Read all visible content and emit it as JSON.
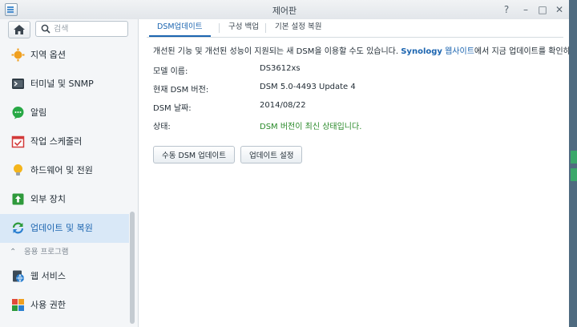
{
  "window": {
    "title": "제어판"
  },
  "search": {
    "placeholder": "검색"
  },
  "sidebar": {
    "items": [
      {
        "label": "지역 옵션"
      },
      {
        "label": "터미널 및 SNMP"
      },
      {
        "label": "알림"
      },
      {
        "label": "작업 스케줄러"
      },
      {
        "label": "하드웨어 및 전원"
      },
      {
        "label": "외부 장치"
      },
      {
        "label": "업데이트 및 복원",
        "active": true
      }
    ],
    "section": {
      "label": "응용 프로그램"
    },
    "items2": [
      {
        "label": "웹 서비스"
      },
      {
        "label": "사용 권한"
      }
    ]
  },
  "tabs": [
    {
      "label": "DSM업데이트",
      "active": true
    },
    {
      "label": "구성 백업"
    },
    {
      "label": "기본 설정 복원"
    }
  ],
  "description": {
    "prefix": "개선된 기능 및 개선된 성능이 지원되는 새 DSM을 이용할 수도 있습니다. ",
    "brand": "Synology",
    "link": " 웹사이트",
    "suffix": "에서 지금 업데이트를 확인하십시오."
  },
  "info": {
    "model_label": "모델 이름:",
    "model_value": "DS3612xs",
    "version_label": "현재 DSM 버전:",
    "version_value": "DSM 5.0-4493 Update 4",
    "date_label": "DSM 날짜:",
    "date_value": "2014/08/22",
    "status_label": "상태:",
    "status_value": "DSM 버전이 최신 상태입니다."
  },
  "buttons": {
    "manual_update": "수동 DSM 업데이트",
    "update_settings": "업데이트 설정"
  },
  "colors": {
    "accent": "#1c65b0",
    "status_ok": "#2a8a2a",
    "active_bg": "#d9e8f7"
  }
}
